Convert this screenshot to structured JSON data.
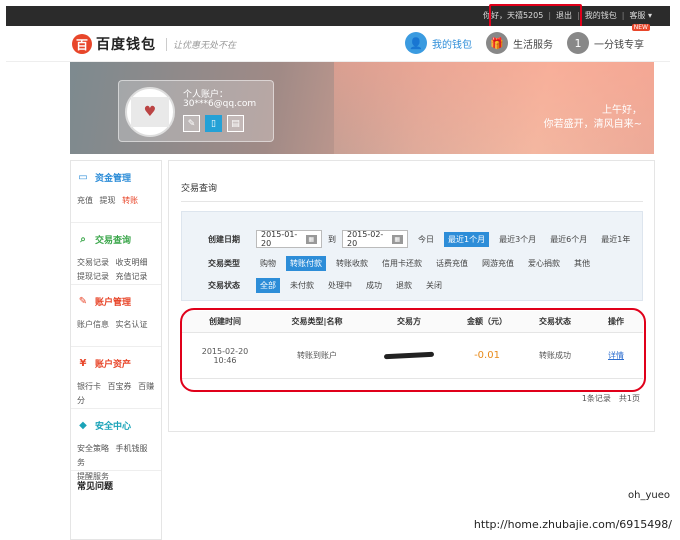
{
  "topbar": {
    "greeting": "你好，天禧5205",
    "logout": "退出",
    "my_wallet": "我的钱包",
    "service": "客服 ▾"
  },
  "header": {
    "logo_mark": "百",
    "logo_text": "百度钱包",
    "slogan": "让优惠无处不在",
    "nav": [
      {
        "label": "我的钱包",
        "icon": "user-icon",
        "glyph": "👤"
      },
      {
        "label": "生活服务",
        "icon": "gift-icon",
        "glyph": "🎁"
      },
      {
        "label": "一分钱专享",
        "icon": "coin-icon",
        "glyph": "1"
      }
    ],
    "new_badge": "NEW"
  },
  "banner": {
    "account_label": "个人账户：",
    "email": "30***6@qq.com",
    "greeting_line1": "上午好，",
    "greeting_line2": "你若盛开，清风自来~"
  },
  "sidebar": {
    "sections": [
      {
        "title": "资金管理",
        "icon": "fund-icon",
        "glyph": "▭",
        "color": "#2d8dd8",
        "links": [
          "充值",
          "提现",
          "转账"
        ]
      },
      {
        "title": "交易查询",
        "icon": "search-icon",
        "glyph": "⌕",
        "color": "#3aa64a",
        "links": [
          "交易记录",
          "收支明细",
          "提现记录",
          "充值记录"
        ]
      },
      {
        "title": "账户管理",
        "icon": "edit-icon",
        "glyph": "✎",
        "color": "#e8462a",
        "links": [
          "账户信息",
          "实名认证"
        ]
      },
      {
        "title": "账户资产",
        "icon": "yen-icon",
        "glyph": "¥",
        "color": "#e8462a",
        "links": [
          "银行卡",
          "百宝券",
          "百赚分"
        ]
      },
      {
        "title": "安全中心",
        "icon": "shield-icon",
        "glyph": "◆",
        "color": "#1aa3b8",
        "links": [
          "安全策略",
          "手机钱服务",
          "提醒服务"
        ]
      }
    ],
    "faq": "常见问题"
  },
  "main": {
    "title": "交易查询",
    "filters": {
      "date_label": "创建日期",
      "date_from": "2015-01-20",
      "date_to": "2015-02-20",
      "date_sep": "到",
      "date_options": [
        "今日",
        "最近1个月",
        "最近3个月",
        "最近6个月",
        "最近1年"
      ],
      "type_label": "交易类型",
      "type_options": [
        "购物",
        "转账付款",
        "转账收款",
        "信用卡还款",
        "话费充值",
        "网游充值",
        "爱心捐款",
        "其他"
      ],
      "status_label": "交易状态",
      "status_options": [
        "全部",
        "未付款",
        "处理中",
        "成功",
        "退款",
        "关闭"
      ]
    },
    "table": {
      "headers": [
        "创建时间",
        "交易类型|名称",
        "交易方",
        "金额（元）",
        "交易状态",
        "操作"
      ],
      "rows": [
        {
          "date": "2015-02-20",
          "time": "10:46",
          "type": "转账到账户",
          "amount": "-0.01",
          "status": "转账成功",
          "action": "详情"
        }
      ]
    },
    "pager": {
      "records": "1条记录",
      "pages": "共1页"
    }
  },
  "watermark": {
    "user": "oh_yueo",
    "url": "http://home.zhubajie.com/6915498/"
  }
}
